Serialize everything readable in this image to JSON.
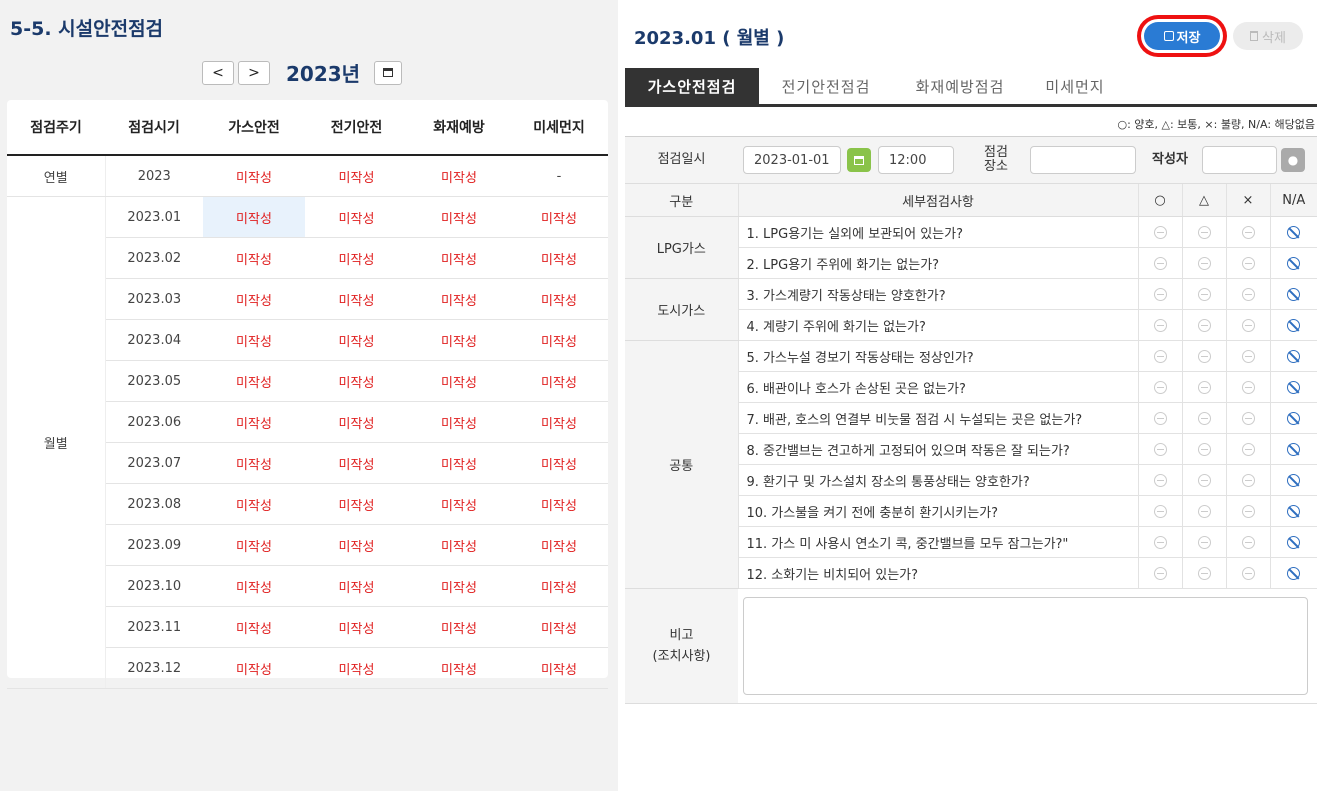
{
  "page_title": "5-5. 시설안전점검",
  "year_nav": {
    "prev": "<",
    "next": ">",
    "year": "2023년",
    "calendar_icon": "calendar-icon"
  },
  "list": {
    "headers": [
      "점검주기",
      "점검시기",
      "가스안전",
      "전기안전",
      "화재예방",
      "미세먼지"
    ],
    "annual": {
      "period": "연별",
      "time": "2023",
      "gas": "미작성",
      "elec": "미작성",
      "fire": "미작성",
      "dust": "-"
    },
    "monthly_label": "월별",
    "monthly": [
      {
        "time": "2023.01",
        "gas": "미작성",
        "elec": "미작성",
        "fire": "미작성",
        "dust": "미작성"
      },
      {
        "time": "2023.02",
        "gas": "미작성",
        "elec": "미작성",
        "fire": "미작성",
        "dust": "미작성"
      },
      {
        "time": "2023.03",
        "gas": "미작성",
        "elec": "미작성",
        "fire": "미작성",
        "dust": "미작성"
      },
      {
        "time": "2023.04",
        "gas": "미작성",
        "elec": "미작성",
        "fire": "미작성",
        "dust": "미작성"
      },
      {
        "time": "2023.05",
        "gas": "미작성",
        "elec": "미작성",
        "fire": "미작성",
        "dust": "미작성"
      },
      {
        "time": "2023.06",
        "gas": "미작성",
        "elec": "미작성",
        "fire": "미작성",
        "dust": "미작성"
      },
      {
        "time": "2023.07",
        "gas": "미작성",
        "elec": "미작성",
        "fire": "미작성",
        "dust": "미작성"
      },
      {
        "time": "2023.08",
        "gas": "미작성",
        "elec": "미작성",
        "fire": "미작성",
        "dust": "미작성"
      },
      {
        "time": "2023.09",
        "gas": "미작성",
        "elec": "미작성",
        "fire": "미작성",
        "dust": "미작성"
      },
      {
        "time": "2023.10",
        "gas": "미작성",
        "elec": "미작성",
        "fire": "미작성",
        "dust": "미작성"
      },
      {
        "time": "2023.11",
        "gas": "미작성",
        "elec": "미작성",
        "fire": "미작성",
        "dust": "미작성"
      },
      {
        "time": "2023.12",
        "gas": "미작성",
        "elec": "미작성",
        "fire": "미작성",
        "dust": "미작성"
      }
    ]
  },
  "detail": {
    "title": "2023.01 ( 월별 )",
    "save_label": "저장",
    "delete_label": "삭제",
    "tabs": [
      "가스안전점검",
      "전기안전점검",
      "화재예방점검",
      "미세먼지"
    ],
    "legend": "○: 양호,  △: 보통,  ×: 불량,  N/A: 해당없음",
    "date_label": "점검일시",
    "date_value": "2023-01-01",
    "time_value": "12:00",
    "place_label_1": "점검",
    "place_label_2": "장소",
    "place_value": "",
    "writer_label": "작성자",
    "writer_value": "",
    "col_category": "구분",
    "col_item": "세부점검사항",
    "col_good": "○",
    "col_fair": "△",
    "col_bad": "×",
    "col_na": "N/A",
    "categories": [
      "LPG가스",
      "도시가스",
      "공통"
    ],
    "items": [
      "1. LPG용기는 실외에 보관되어 있는가?",
      "2. LPG용기 주위에 화기는 없는가?",
      "3. 가스계량기 작동상태는 양호한가?",
      "4. 계량기 주위에 화기는 없는가?",
      "5. 가스누설 경보기 작동상태는 정상인가?",
      "6. 배관이나 호스가 손상된 곳은 없는가?",
      "7. 배관, 호스의 연결부 비눗물 점검 시 누설되는 곳은 없는가?",
      "8. 중간밸브는 견고하게 고정되어 있으며 작동은 잘 되는가?",
      "9. 환기구 및 가스설치 장소의 통풍상태는 양호한가?",
      "10. 가스불을 켜기 전에 충분히 환기시키는가?",
      "11. 가스 미 사용시 연소기 콕, 중간밸브를 모두 잠그는가?\"",
      "12. 소화기는 비치되어 있는가?"
    ],
    "note_label_1": "비고",
    "note_label_2": "(조치사항)"
  },
  "colors": {
    "accent": "#1b3a6b",
    "save": "#2a7bd4",
    "highlight": "#ee1111",
    "status_red": "#e02020",
    "na_blue": "#2f6fc0"
  }
}
